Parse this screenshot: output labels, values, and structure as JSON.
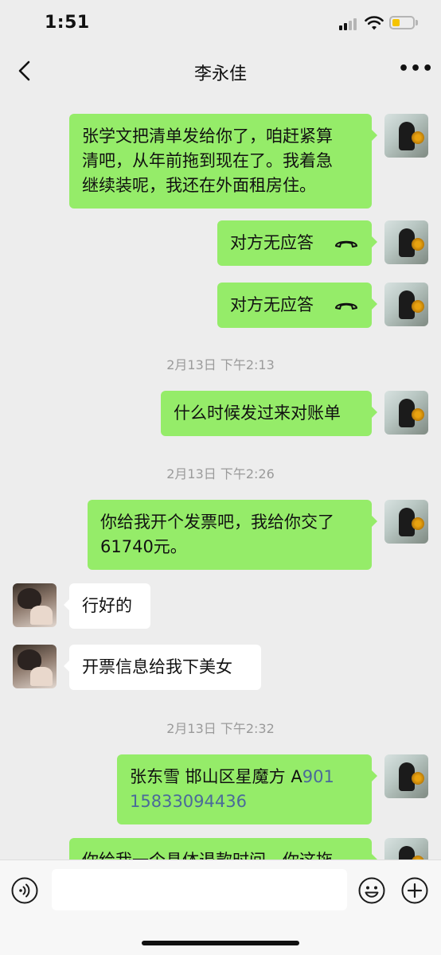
{
  "status_bar": {
    "time": "1:51"
  },
  "header": {
    "title": "李永佳"
  },
  "messages": [
    {
      "sender": "me",
      "lines": [
        "张学文把清单发给你了，咱赶紧算",
        "清吧，从年前拖到现在了。我着急",
        "继续装呢，我还在外面租房住。"
      ]
    },
    {
      "sender": "me",
      "text": "对方无应答",
      "icon": "phone-icon"
    },
    {
      "sender": "me",
      "text": "对方无应答",
      "icon": "phone-icon"
    },
    {
      "timestamp": "2月13日 下午2:13"
    },
    {
      "sender": "me",
      "text": "什么时候发过来对账单"
    },
    {
      "timestamp": "2月13日 下午2:26"
    },
    {
      "sender": "me",
      "lines": [
        "你给我开个发票吧，我给你交了",
        "61740元。"
      ]
    },
    {
      "sender": "other",
      "text": "行好的"
    },
    {
      "sender": "other",
      "text": "开票信息给我下美女"
    },
    {
      "timestamp": "2月13日 下午2:32"
    },
    {
      "sender": "me",
      "line1_text": "张东雪  邯山区星魔方 A",
      "line1_link": "901",
      "line2_link": "15833094436"
    },
    {
      "sender": "me",
      "text": "你给我一个具体退款时间，你这拖"
    }
  ],
  "input_bar": {
    "placeholder": ""
  },
  "icons": {
    "back": "chevron-left-icon",
    "more": "more-dots-icon",
    "voice": "voice-icon",
    "emoji": "emoji-icon",
    "plus": "plus-icon"
  },
  "colors": {
    "my_bubble": "#95ec69",
    "other_bubble": "#ffffff",
    "background": "#ededed",
    "link": "#4a6a9a"
  }
}
